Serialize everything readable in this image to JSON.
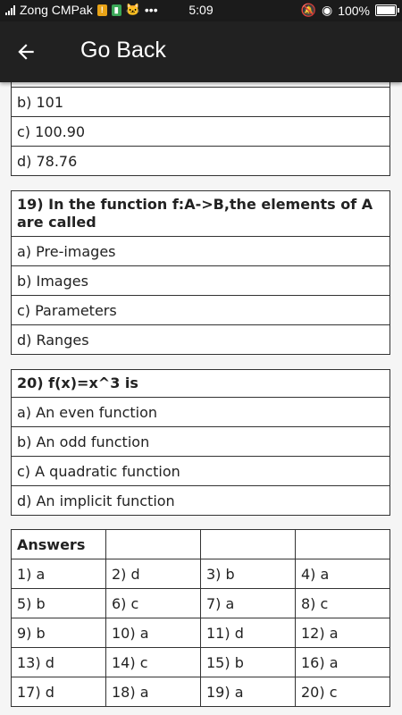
{
  "status": {
    "carrier": "Zong CMPak",
    "time": "5:09",
    "battery": "100%"
  },
  "appbar": {
    "title": "Go Back"
  },
  "q18_options": [
    "b) 101",
    "c) 100.90",
    "d) 78.76"
  ],
  "q19": {
    "question": "19) In the function f:A->B,the elements of A are called",
    "options": [
      "a) Pre-images",
      "b) Images",
      "c) Parameters",
      "d) Ranges"
    ]
  },
  "q20": {
    "question": "20) f(x)=x^3 is",
    "options": [
      "a) An even function",
      "b) An odd function",
      "c) A quadratic function",
      "d) An implicit function"
    ]
  },
  "answers": {
    "header": "Answers",
    "rows": [
      [
        "1) a",
        "2) d",
        "3) b",
        "4) a"
      ],
      [
        "5) b",
        "6) c",
        "7) a",
        "8) c"
      ],
      [
        "9) b",
        "10) a",
        "11) d",
        "12) a"
      ],
      [
        "13) d",
        "14) c",
        "15) b",
        "16) a"
      ],
      [
        "17) d",
        "18) a",
        "19) a",
        "20) c"
      ]
    ]
  }
}
